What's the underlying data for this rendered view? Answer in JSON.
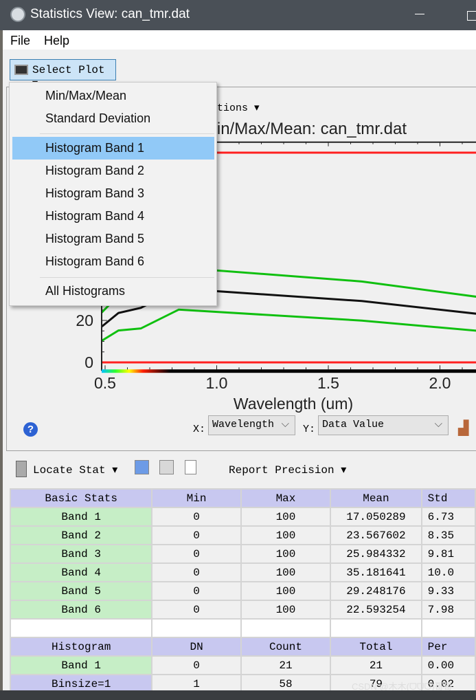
{
  "window": {
    "title": "Statistics View: can_tmr.dat"
  },
  "menubar": {
    "file": "File",
    "help": "Help"
  },
  "toolbar": {
    "select_plot": "Select Plot ▾"
  },
  "dropdown": {
    "items": [
      "Min/Max/Mean",
      "Standard Deviation",
      "Histogram Band 1",
      "Histogram Band 2",
      "Histogram Band 3",
      "Histogram Band 4",
      "Histogram Band 5",
      "Histogram Band 6",
      "All Histograms"
    ],
    "highlighted": "Histogram Band 1"
  },
  "plot": {
    "options_label": "tions ▾",
    "title": "Min/Max/Mean: can_tmr.dat",
    "x_axis_label": "X:",
    "x_select": "Wavelength",
    "y_axis_label": "Y:",
    "y_select": "Data Value"
  },
  "chart_data": {
    "type": "line",
    "title": "Min/Max/Mean: can_tmr.dat",
    "xlabel": "Wavelength (um)",
    "ylabel": "",
    "xlim": [
      0.48,
      2.2
    ],
    "ylim": [
      -4,
      105
    ],
    "x_ticks": [
      "0.5",
      "1.0",
      "1.5",
      "2.0"
    ],
    "y_ticks": [
      "0",
      "20"
    ],
    "x": [
      0.485,
      0.56,
      0.66,
      0.83,
      1.65,
      2.215
    ],
    "series": [
      {
        "role": "max",
        "color": "#ff2020",
        "values": [
          100,
          100,
          100,
          100,
          100,
          100
        ]
      },
      {
        "role": "min",
        "color": "#ff2020",
        "values": [
          0,
          0,
          0,
          0,
          0,
          0
        ]
      },
      {
        "role": "mean",
        "color": "#111111",
        "values": [
          17.05,
          23.57,
          25.98,
          35.18,
          29.25,
          22.59
        ]
      },
      {
        "role": "mean+stdev",
        "color": "#10c010",
        "values": [
          23.78,
          31.92,
          35.79,
          45.2,
          38.58,
          30.57
        ]
      },
      {
        "role": "mean-stdev",
        "color": "#10c010",
        "values": [
          10.32,
          15.22,
          16.17,
          25.16,
          19.92,
          14.61
        ]
      }
    ]
  },
  "lower_toolbar": {
    "locate_stat": "Locate Stat ▾",
    "report_precision": "Report Precision ▾"
  },
  "basic_stats": {
    "headers": [
      "Basic Stats",
      "Min",
      "Max",
      "Mean",
      "Std"
    ],
    "rows": [
      [
        "Band 1",
        "0",
        "100",
        "17.050289",
        "6.73"
      ],
      [
        "Band 2",
        "0",
        "100",
        "23.567602",
        "8.35"
      ],
      [
        "Band 3",
        "0",
        "100",
        "25.984332",
        "9.81"
      ],
      [
        "Band 4",
        "0",
        "100",
        "35.181641",
        "10.0"
      ],
      [
        "Band 5",
        "0",
        "100",
        "29.248176",
        "9.33"
      ],
      [
        "Band 6",
        "0",
        "100",
        "22.593254",
        "7.98"
      ]
    ]
  },
  "histogram": {
    "headers": [
      "Histogram",
      "DN",
      "Count",
      "Total",
      "Per"
    ],
    "rows": [
      [
        "Band 1",
        "0",
        "21",
        "21",
        "0.00"
      ],
      [
        "Binsize=1",
        "1",
        "58",
        "79",
        "0.02"
      ]
    ]
  },
  "watermark": "CSDN @木木(ᗜᗜᗜ)哥哥"
}
